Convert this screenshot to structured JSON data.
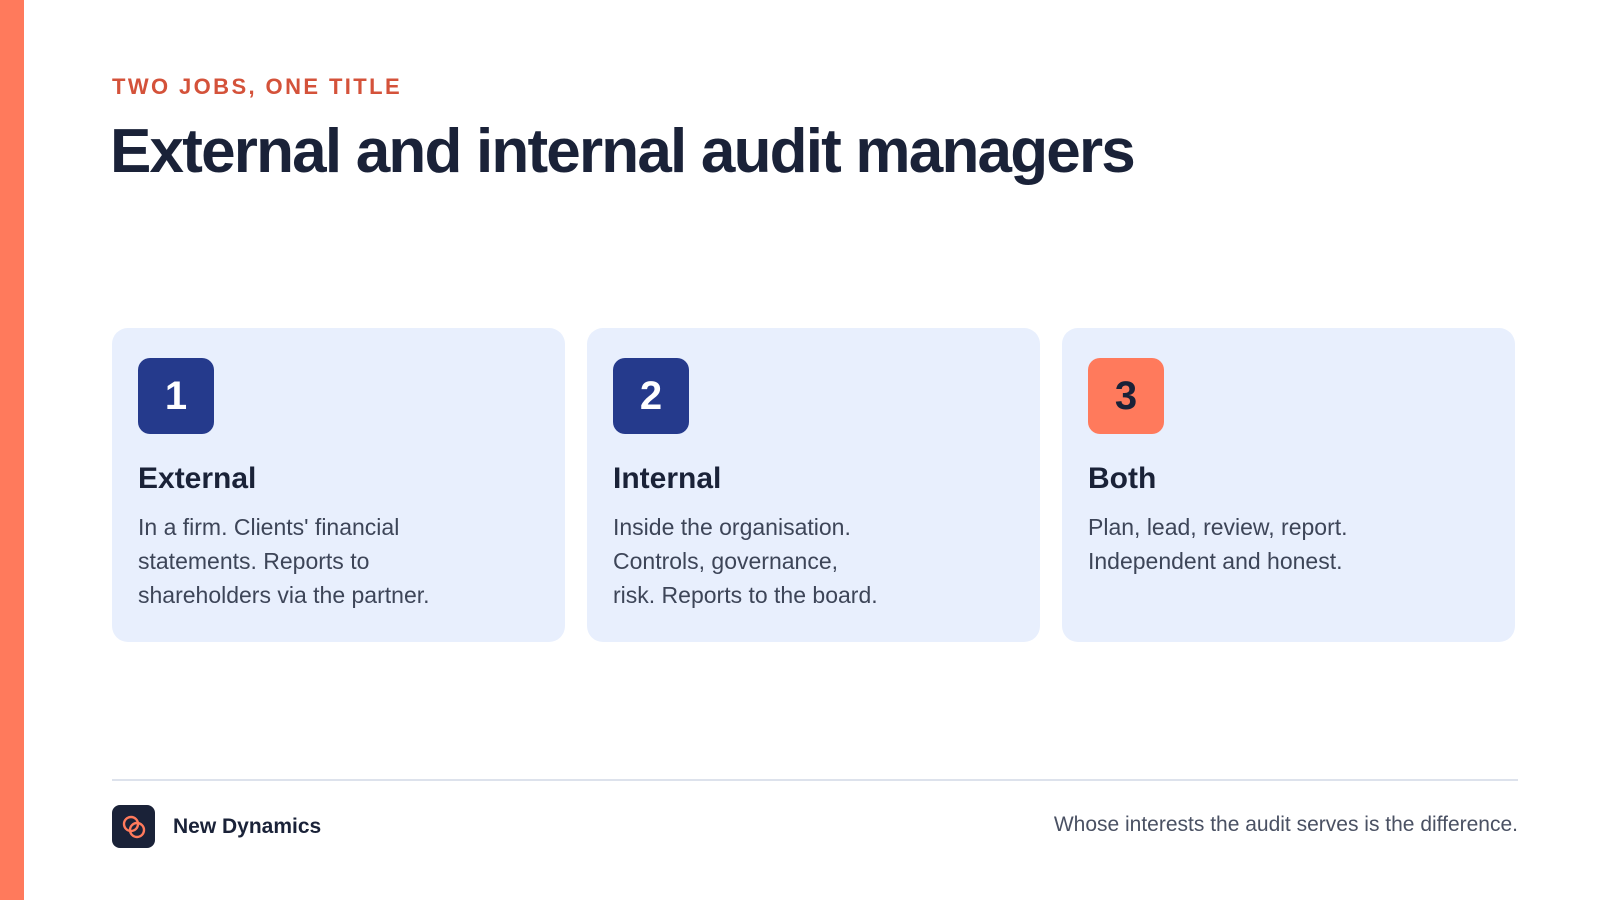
{
  "slide": {
    "eyebrow": "TWO JOBS, ONE TITLE",
    "title": "External and internal audit managers"
  },
  "cards": [
    {
      "number": "1",
      "heading": "External",
      "lines": [
        "In a firm. Clients' financial",
        "statements. Reports to",
        "shareholders via the partner."
      ],
      "badge_color": "#253A8C"
    },
    {
      "number": "2",
      "heading": "Internal",
      "lines": [
        "Inside the organisation.",
        "Controls, governance,",
        "risk. Reports to the board."
      ],
      "badge_color": "#253A8C"
    },
    {
      "number": "3",
      "heading": "Both",
      "lines": [
        "Plan, lead, review, report.",
        "Independent and honest."
      ],
      "badge_color": "#FF7A5C"
    }
  ],
  "footer": {
    "brand_name": "New Dynamics",
    "brand_icon": "interlocking-rings-icon",
    "note": "Whose interests the audit serves is the difference."
  },
  "colors": {
    "accent": "#FF7A5C",
    "eyebrow": "#D4523A",
    "navy": "#1A2238",
    "card_bg": "#E8EFFD"
  }
}
